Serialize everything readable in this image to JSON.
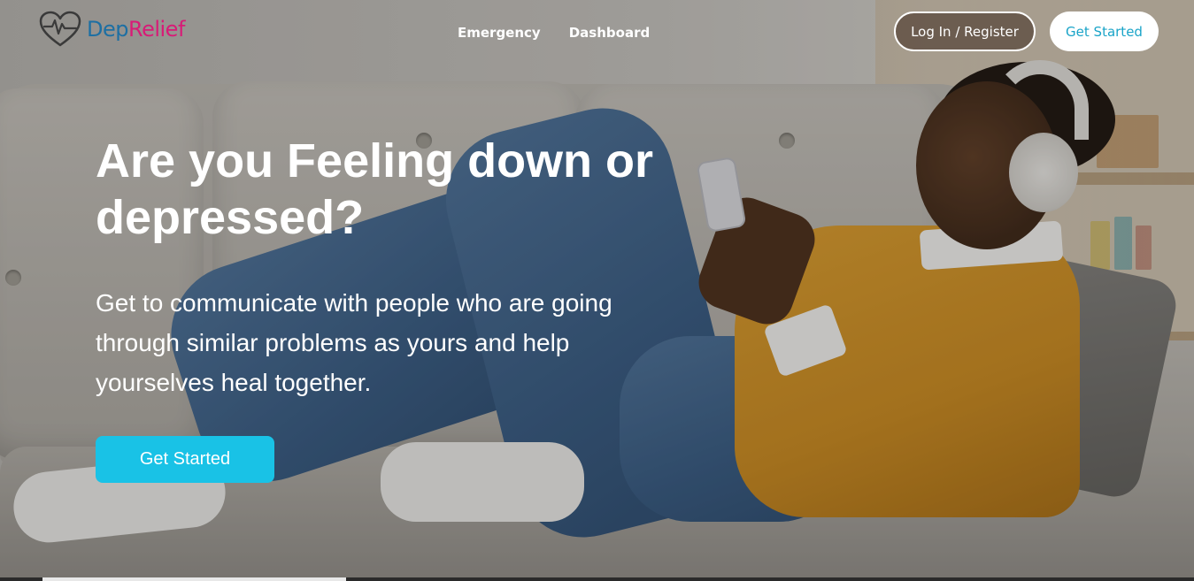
{
  "brand": {
    "name_part1": "Dep",
    "name_part2": "Relief",
    "icon": "heart-pulse-icon",
    "color_part1": "#1d6fa3",
    "color_part2": "#d81b77"
  },
  "nav": {
    "links": [
      {
        "label": "Emergency"
      },
      {
        "label": "Dashboard"
      }
    ],
    "login_label": "Log In / Register",
    "get_started_label": "Get Started"
  },
  "hero": {
    "headline": "Are you Feeling down or depressed?",
    "subtext": "Get to communicate with people who are going through similar problems as yours and help yourselves heal together.",
    "cta_label": "Get Started",
    "cta_color": "#19c2e6"
  }
}
